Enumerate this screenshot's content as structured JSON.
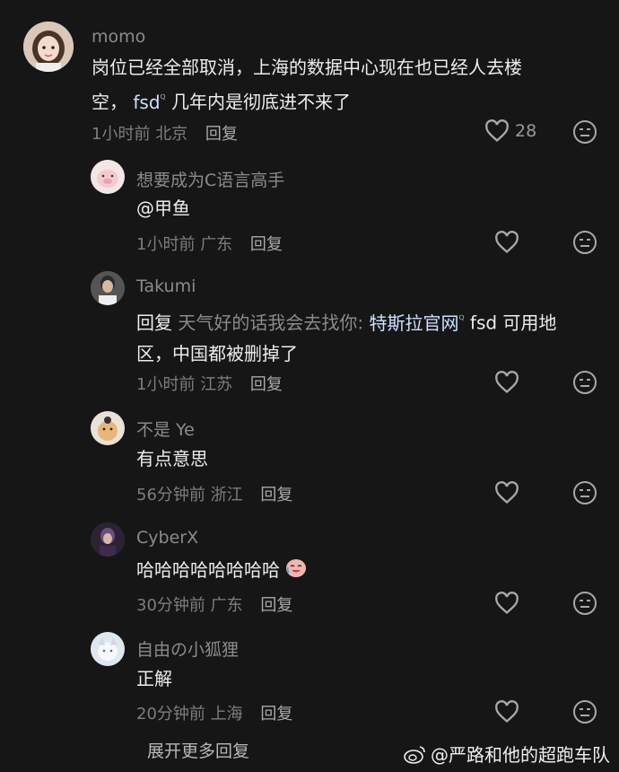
{
  "comments": [
    {
      "username": "momo",
      "text_a": "岗位已经全部取消，上海的数据中心现在也已经人去楼",
      "text_b1": "空，",
      "text_b_link": " fsd",
      "text_b2": " 几年内是彻底进不来了",
      "time": "1小时前",
      "location": "北京",
      "reply_label": "回复",
      "likes": "28"
    },
    {
      "username": "想要成为C语言高手",
      "text": "@甲鱼",
      "time": "1小时前",
      "location": "广东",
      "reply_label": "回复"
    },
    {
      "username": "Takumi",
      "reply_word": "回复",
      "reply_to": " 天气好的话我会去找你: ",
      "link_text": "特斯拉官网",
      "text_a2": " fsd 可用地",
      "text_b": "区，中国都被删掉了",
      "time": "1小时前",
      "location": "江苏",
      "reply_label": "回复"
    },
    {
      "username": "不是 Ye",
      "text": "有点意思",
      "time": "56分钟前",
      "location": "浙江",
      "reply_label": "回复"
    },
    {
      "username": "CyberX",
      "text": "哈哈哈哈哈哈哈哈",
      "time": "30分钟前",
      "location": "广东",
      "reply_label": "回复"
    },
    {
      "username": "自由の小狐狸",
      "text": "正解",
      "time": "20分钟前",
      "location": "上海",
      "reply_label": "回复"
    }
  ],
  "expand_more": "展开更多回复",
  "watermark": "@严路和他的超跑车队",
  "icons": {
    "like": "heart-outline-icon",
    "dislike": "meh-face-icon",
    "search": "search-icon"
  }
}
